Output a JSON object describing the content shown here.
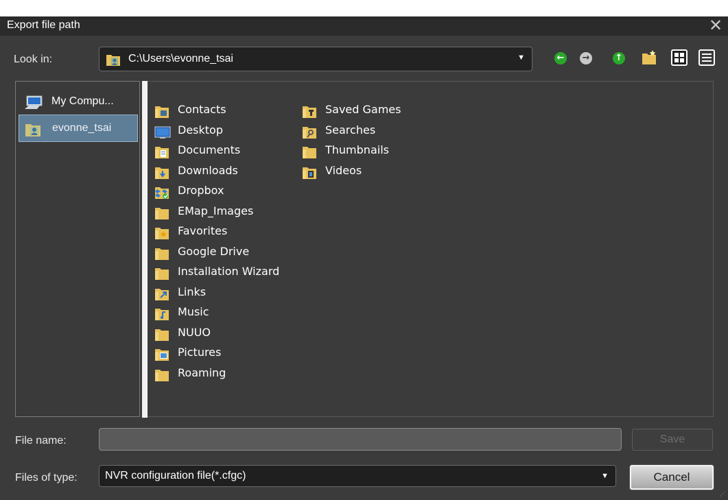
{
  "dialog": {
    "title": "Export file path",
    "close_glyph": "✕"
  },
  "look_in": {
    "label": "Look in:",
    "path": "C:\\Users\\evonne_tsai"
  },
  "toolbar": {
    "back_glyph": "←",
    "forward_glyph": "→",
    "up_glyph": "↑",
    "colors": {
      "nav_green": "#2aa82a",
      "nav_gray": "#c9c9c9",
      "folder": "#e8c15a"
    }
  },
  "places": [
    {
      "label": "My Compu...",
      "icon": "computer-icon",
      "selected": false
    },
    {
      "label": "evonne_tsai",
      "icon": "user-folder-icon",
      "selected": true
    }
  ],
  "files": {
    "column1": [
      {
        "label": "Contacts",
        "icon": "contacts-folder-icon"
      },
      {
        "label": "Desktop",
        "icon": "desktop-icon"
      },
      {
        "label": "Documents",
        "icon": "documents-folder-icon"
      },
      {
        "label": "Downloads",
        "icon": "downloads-folder-icon"
      },
      {
        "label": "Dropbox",
        "icon": "dropbox-icon"
      },
      {
        "label": "EMap_Images",
        "icon": "folder-icon"
      },
      {
        "label": "Favorites",
        "icon": "favorites-folder-icon"
      },
      {
        "label": "Google Drive",
        "icon": "folder-icon"
      },
      {
        "label": "Installation Wizard",
        "icon": "folder-icon"
      },
      {
        "label": "Links",
        "icon": "links-folder-icon"
      },
      {
        "label": "Music",
        "icon": "music-folder-icon"
      },
      {
        "label": "NUUO",
        "icon": "folder-icon"
      },
      {
        "label": "Pictures",
        "icon": "pictures-folder-icon"
      },
      {
        "label": "Roaming",
        "icon": "folder-icon"
      }
    ],
    "column2": [
      {
        "label": "Saved Games",
        "icon": "saved-games-folder-icon"
      },
      {
        "label": "Searches",
        "icon": "searches-folder-icon"
      },
      {
        "label": "Thumbnails",
        "icon": "folder-icon"
      },
      {
        "label": "Videos",
        "icon": "videos-folder-icon"
      }
    ]
  },
  "file_name": {
    "label": "File name:",
    "value": "",
    "placeholder": ""
  },
  "files_of_type": {
    "label": "Files of type:",
    "value": "NVR configuration file(*.cfgc)"
  },
  "buttons": {
    "save": "Save",
    "cancel": "Cancel"
  }
}
